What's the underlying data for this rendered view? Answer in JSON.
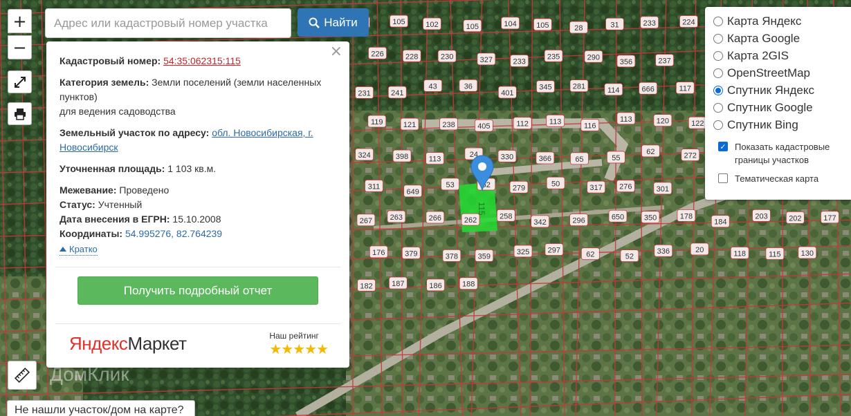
{
  "map": {
    "parcel_numbers": [
      "104",
      "105",
      "102",
      "105",
      "104",
      "105",
      "28",
      "31",
      "233",
      "224",
      "226",
      "228",
      "230",
      "327",
      "233",
      "235",
      "290",
      "356",
      "237",
      "231",
      "241",
      "43",
      "36",
      "401",
      "345",
      "281",
      "114",
      "666",
      "117",
      "119",
      "121",
      "238",
      "405",
      "112",
      "113",
      "116",
      "113",
      "120",
      "122",
      "324",
      "398",
      "113",
      "24",
      "330",
      "366",
      "65",
      "55",
      "62",
      "272",
      "311",
      "649",
      "53",
      "52",
      "279",
      "50",
      "317",
      "276",
      "301",
      "267",
      "263",
      "266",
      "262",
      "258",
      "342",
      "296",
      "650",
      "350",
      "178",
      "184",
      "203",
      "202",
      "177",
      "176",
      "379",
      "378",
      "359",
      "325",
      "297",
      "62",
      "52",
      "336",
      "20",
      "118",
      "115",
      "130",
      "182",
      "187",
      "186",
      "188"
    ],
    "selected_parcel_label": "115",
    "colors": {
      "parcel_border": "#c23a3a",
      "parcel_label_bg": "#f2e8e8",
      "selected_fill": "#22dd33",
      "pin": "#3b8ede"
    }
  },
  "controls": {
    "zoom_in": "+",
    "zoom_out": "−",
    "fullscreen_icon": "expand-icon",
    "print_icon": "printer-icon",
    "ruler_icon": "ruler-icon"
  },
  "search": {
    "placeholder": "Адрес или кадастровый номер участка",
    "button_label": "Найти"
  },
  "info": {
    "cadastral_label": "Кадастровый номер:",
    "cadastral_value": "54:35:062315:115",
    "category_label": "Категория земель:",
    "category_value": "Земли поселений (земли населенных пунктов)",
    "category_use": "для ведения садоводства",
    "address_label": "Земельный участок по адресу:",
    "address_value": "обл. Новосибирская, г. Новосибирск",
    "area_label": "Уточненная площадь:",
    "area_value": "1 103 кв.м.",
    "survey_label": "Межевание:",
    "survey_value": "Проведено",
    "status_label": "Статус:",
    "status_value": "Учтенный",
    "egrn_label": "Дата внесения в ЕГРН:",
    "egrn_value": "15.10.2008",
    "coords_label": "Координаты:",
    "coords_value": "54.995276, 82.764239",
    "short_link": "Кратко",
    "report_button": "Получить подробный отчет",
    "close": "×"
  },
  "market": {
    "logo_brand": "Яндекс",
    "logo_product": "Маркет",
    "rating_label": "Наш рейтинг",
    "stars": "★★★★★"
  },
  "layers": {
    "options": [
      "Карта Яндекс",
      "Карта Google",
      "Карта 2GIS",
      "OpenStreetMap",
      "Спутник Яндекс",
      "Спутник Google",
      "Спутник Bing"
    ],
    "selected": "Спутник Яндекс",
    "show_borders": "Показать кадастровые границы участков",
    "thematic": "Тематическая карта"
  },
  "feedback": {
    "not_found": "Не нашли участок/дом на карте?"
  },
  "watermark": "ДомКлик"
}
